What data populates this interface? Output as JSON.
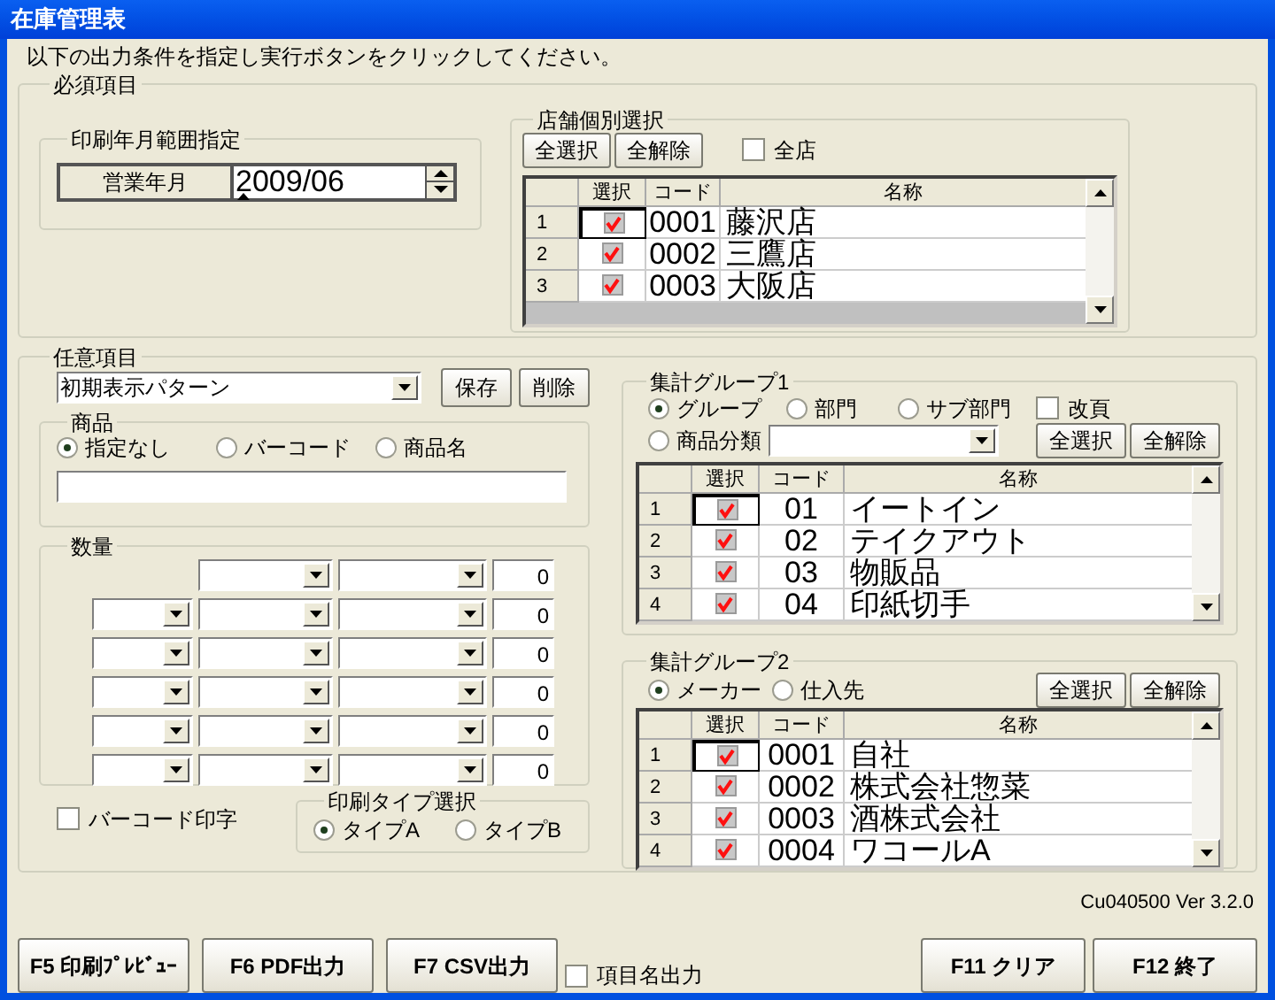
{
  "window": {
    "title": "在庫管理表"
  },
  "instruction": "以下の出力条件を指定し実行ボタンをクリックしてください。",
  "required_section": {
    "title": "必須項目",
    "print_period": {
      "title": "印刷年月範囲指定",
      "label": "営業年月",
      "value": "2009/06"
    },
    "store_selection": {
      "title": "店舗個別選択",
      "buttons": [
        "全選択",
        "全解除"
      ],
      "all_stores": {
        "label": "全店",
        "checked": false
      },
      "grid": {
        "columns": [
          "選択",
          "コード",
          "名称"
        ],
        "rows": [
          {
            "number": "1",
            "checked": true,
            "current": true,
            "code": "0001",
            "name": "藤沢店"
          },
          {
            "number": "2",
            "checked": true,
            "current": false,
            "code": "0002",
            "name": "三鷹店"
          },
          {
            "number": "3",
            "checked": true,
            "current": false,
            "code": "0003",
            "name": "大阪店"
          }
        ]
      }
    }
  },
  "optional_section": {
    "title": "任意項目",
    "pattern": {
      "value": "初期表示パターン"
    },
    "buttons": [
      "保存",
      "削除"
    ],
    "product": {
      "title": "商品",
      "options": [
        {
          "label": "指定なし",
          "selected": true
        },
        {
          "label": "バーコード",
          "selected": false
        },
        {
          "label": "商品名",
          "selected": false
        }
      ]
    },
    "quantity": {
      "title": "数量",
      "rows": [
        {
          "kind": "short",
          "value": "0"
        },
        {
          "kind": "full",
          "value": "0"
        },
        {
          "kind": "full",
          "value": "0"
        },
        {
          "kind": "full",
          "value": "0"
        },
        {
          "kind": "full",
          "value": "0"
        },
        {
          "kind": "full",
          "value": "0"
        }
      ]
    },
    "barcode_print": {
      "label": "バーコード印字",
      "checked": false
    },
    "print_type": {
      "title": "印刷タイプ選択",
      "options": [
        {
          "label": "タイプA",
          "selected": true
        },
        {
          "label": "タイプB",
          "selected": false
        }
      ]
    },
    "group1": {
      "title": "集計グループ1",
      "options": [
        {
          "label": "グループ",
          "selected": true
        },
        {
          "label": "部門",
          "selected": false
        },
        {
          "label": "サブ部門",
          "selected": false
        },
        {
          "label": "商品分類",
          "selected": false
        }
      ],
      "page_break": {
        "label": "改頁",
        "checked": false
      },
      "buttons": [
        "全選択",
        "全解除"
      ],
      "grid": {
        "columns": [
          "選択",
          "コード",
          "名称"
        ],
        "rows": [
          {
            "number": "1",
            "checked": true,
            "current": true,
            "code": "01",
            "name": "イートイン"
          },
          {
            "number": "2",
            "checked": true,
            "current": false,
            "code": "02",
            "name": "テイクアウト"
          },
          {
            "number": "3",
            "checked": true,
            "current": false,
            "code": "03",
            "name": "物販品"
          },
          {
            "number": "4",
            "checked": true,
            "current": false,
            "code": "04",
            "name": "印紙切手"
          }
        ]
      }
    },
    "group2": {
      "title": "集計グループ2",
      "options": [
        {
          "label": "メーカー",
          "selected": true
        },
        {
          "label": "仕入先",
          "selected": false
        }
      ],
      "buttons": [
        "全選択",
        "全解除"
      ],
      "grid": {
        "columns": [
          "選択",
          "コード",
          "名称"
        ],
        "rows": [
          {
            "number": "1",
            "checked": true,
            "current": true,
            "code": "0001",
            "name": "自社"
          },
          {
            "number": "2",
            "checked": true,
            "current": false,
            "code": "0002",
            "name": "株式会社惣菜"
          },
          {
            "number": "3",
            "checked": true,
            "current": false,
            "code": "0003",
            "name": "酒株式会社"
          },
          {
            "number": "4",
            "checked": true,
            "current": false,
            "code": "0004",
            "name": "ワコールA"
          }
        ]
      }
    }
  },
  "version": "Cu040500 Ver 3.2.0",
  "footer": {
    "buttons": [
      "F5 印刷ﾌﾟﾚﾋﾞｭｰ",
      "F6 PDF出力",
      "F7 CSV出力"
    ],
    "item_name_output": {
      "label": "項目名出力",
      "checked": false
    },
    "right_buttons": [
      "F11 クリア",
      "F12 終了"
    ]
  }
}
